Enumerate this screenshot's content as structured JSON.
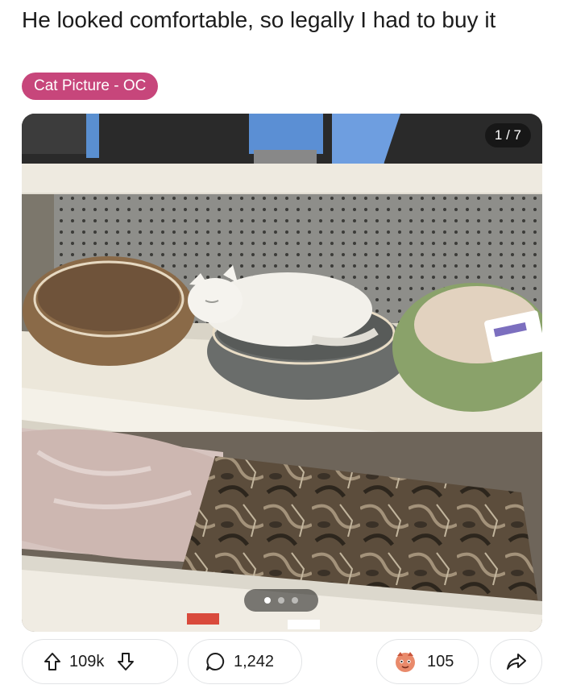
{
  "post": {
    "title": "He looked comfortable, so legally I had to buy it",
    "flair": "Cat Picture - OC"
  },
  "media": {
    "counter": "1 / 7",
    "slide_count": 3,
    "active_slide": 0
  },
  "actions": {
    "upvotes": "109k",
    "comments": "1,242",
    "awards": "105"
  },
  "colors": {
    "flair_bg": "#c7467b",
    "pill_border": "#e2e4e6"
  },
  "icons": [
    "upvote-icon",
    "downvote-icon",
    "comment-icon",
    "award-icon",
    "share-icon"
  ]
}
